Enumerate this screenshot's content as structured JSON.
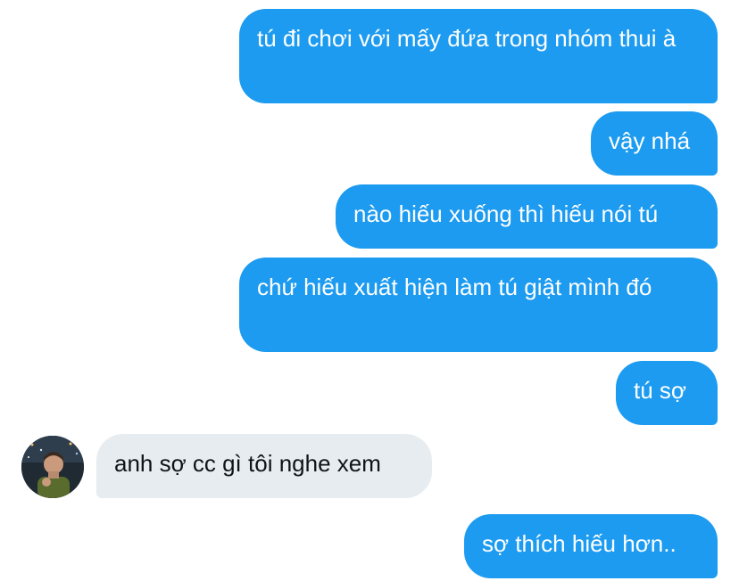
{
  "messages": [
    {
      "direction": "outgoing",
      "text": "tú đi chơi với mấy đứa trong nhóm thui à"
    },
    {
      "direction": "outgoing",
      "text": "vậy nhá"
    },
    {
      "direction": "outgoing",
      "text": "nào hiếu xuống thì hiếu nói tú"
    },
    {
      "direction": "outgoing",
      "text": "chứ hiếu xuất hiện làm tú giật mình đó"
    },
    {
      "direction": "outgoing",
      "text": "tú sợ"
    },
    {
      "direction": "incoming",
      "text": "anh sợ cc gì tôi nghe xem"
    },
    {
      "direction": "outgoing",
      "text": "sợ thích hiếu hơn.."
    }
  ],
  "colors": {
    "outgoing_bubble": "#1d9bf0",
    "incoming_bubble": "#e6ecf0",
    "outgoing_text": "#ffffff",
    "incoming_text": "#0f1419"
  },
  "avatar": {
    "icon": "user-avatar-icon"
  }
}
